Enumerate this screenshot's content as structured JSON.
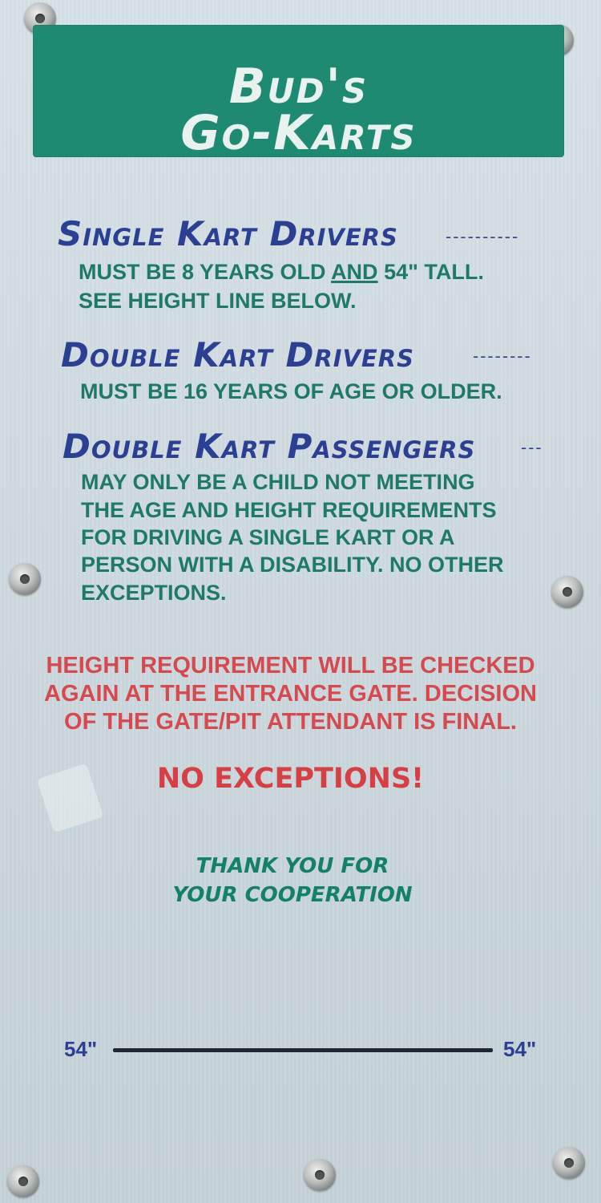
{
  "banner": {
    "line1": "Bud's",
    "line2": "Go-Karts"
  },
  "sections": [
    {
      "heading": "Single Kart Drivers",
      "dashes": "----------",
      "lines": [
        "SEE HEIGHT LINE BELOW."
      ],
      "line1_before": "MUST BE 8 YEARS OLD ",
      "line1_underlined": "AND",
      "line1_after": " 54\" TALL."
    },
    {
      "heading": "Double Kart Drivers",
      "dashes": "--------",
      "lines": [
        "MUST BE 16 YEARS OF AGE OR OLDER."
      ]
    },
    {
      "heading": "Double Kart Passengers",
      "dashes": "---",
      "lines": [
        "MAY ONLY BE A CHILD NOT MEETING",
        "THE AGE AND HEIGHT REQUIREMENTS",
        "FOR DRIVING A SINGLE KART OR A",
        "PERSON WITH A DISABILITY. NO OTHER",
        "EXCEPTIONS."
      ]
    }
  ],
  "warning": {
    "lines": [
      "HEIGHT REQUIREMENT WILL BE CHECKED",
      "AGAIN AT THE ENTRANCE GATE. DECISION",
      "OF THE GATE/PIT ATTENDANT IS FINAL."
    ],
    "no_exceptions": "NO EXCEPTIONS!"
  },
  "thanks": {
    "line1": "THANK YOU FOR",
    "line2": "YOUR COOPERATION"
  },
  "height_line": {
    "left_label": "54\"",
    "right_label": "54\""
  },
  "colors": {
    "banner": "#1f8a72",
    "heading": "#2b3f93",
    "rule_text": "#1f7a63",
    "warning": "#d44a4f"
  }
}
